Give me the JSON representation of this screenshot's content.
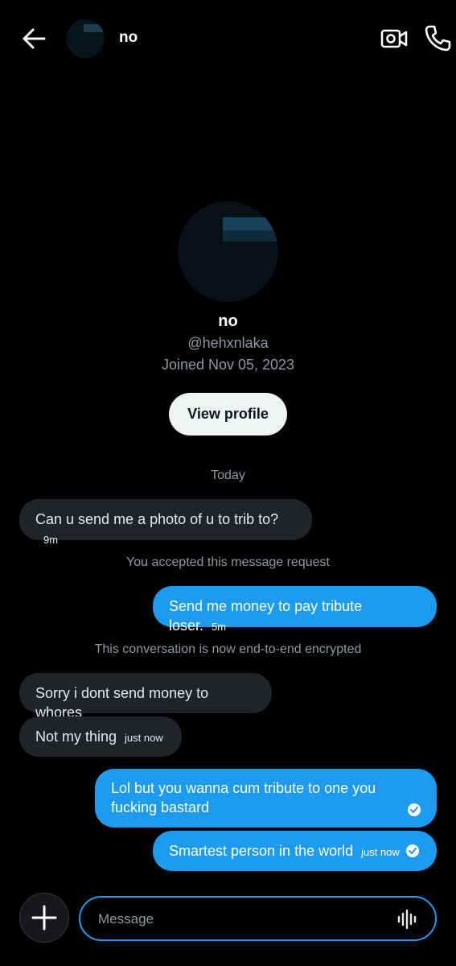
{
  "header": {
    "name": "no"
  },
  "profile": {
    "name": "no",
    "handle": "@hehxnlaka",
    "joined": "Joined Nov 05, 2023",
    "view_profile_label": "View profile"
  },
  "notes": {
    "today": "Today",
    "accepted": "You accepted this message request",
    "encrypted": "This conversation is now end-to-end encrypted"
  },
  "messages": [
    {
      "text": "Can u send me a photo of u to trib to?",
      "time": "9m"
    },
    {
      "text": "Send me money to pay tribute loser.",
      "time": "5m"
    },
    {
      "text": "Sorry i dont send money to whores",
      "time": ""
    },
    {
      "text": "Not my thing",
      "time": "just now"
    },
    {
      "text": "Lol but you wanna cum tribute to one you fucking bastard",
      "time": ""
    },
    {
      "text": "Smartest person in the world",
      "time": "just now"
    }
  ],
  "composer": {
    "placeholder": "Message"
  },
  "colors": {
    "accent": "#1d9bf0",
    "received_bubble": "#202327",
    "background": "#000000"
  }
}
